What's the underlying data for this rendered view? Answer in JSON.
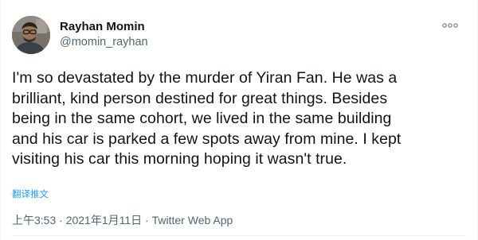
{
  "tweet": {
    "author_name": "Rayhan Momin",
    "author_handle": "@momin_rayhan",
    "avatar_icon": "user-avatar-photo",
    "more_icon": "more-options-icon",
    "body_lines": [
      "I'm so devastated by the murder of Yiran Fan. He was a",
      "brilliant, kind person destined for great things. Besides",
      "being in the same cohort, we lived in the same building",
      "and his car is parked a few spots away from mine. I kept",
      "visiting his car this morning hoping it wasn't true."
    ],
    "translate_label": "翻译推文",
    "timestamp": "上午3:53 · 2021年1月11日 · ",
    "source_app": "Twitter Web App"
  },
  "colors": {
    "text_primary": "#0f1419",
    "text_secondary": "#536471",
    "link": "#1d9bf0"
  }
}
